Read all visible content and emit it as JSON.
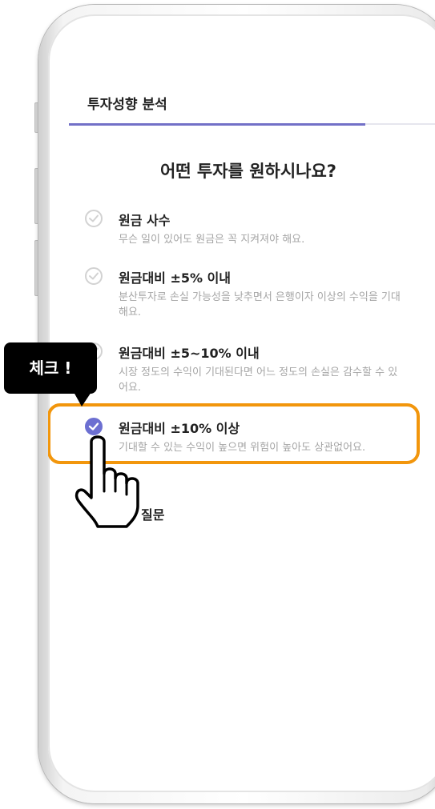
{
  "header": {
    "title": "투자성향 분석"
  },
  "progress": {
    "value": 0.78
  },
  "question": {
    "text": "어떤 투자를 원하시나요?"
  },
  "options": [
    {
      "title": "원금 사수",
      "description": "무슨 일이 있어도 원금은 꼭 지켜져야 해요.",
      "selected": false
    },
    {
      "title": "원금대비 ±5% 이내",
      "description": "분산투자로 손실 가능성을 낮추면서 은행이자 이상의 수익을 기대해요.",
      "selected": false
    },
    {
      "title": "원금대비 ±5~10% 이내",
      "description": "시장 정도의 수익이 기대된다면 어느 정도의 손실은 감수할 수 있어요.",
      "selected": false
    },
    {
      "title": "원금대비 ±10% 이상",
      "description": "기대할 수 있는 수익이 높으면 위험이 높아도 상관없어요.",
      "selected": true
    }
  ],
  "footer": {
    "next_label_partial": "질문"
  },
  "annotation": {
    "callout_text": "체크 !"
  },
  "colors": {
    "accent": "#6c6fd1",
    "highlight": "#f2960c",
    "callout_bg": "#000000"
  }
}
